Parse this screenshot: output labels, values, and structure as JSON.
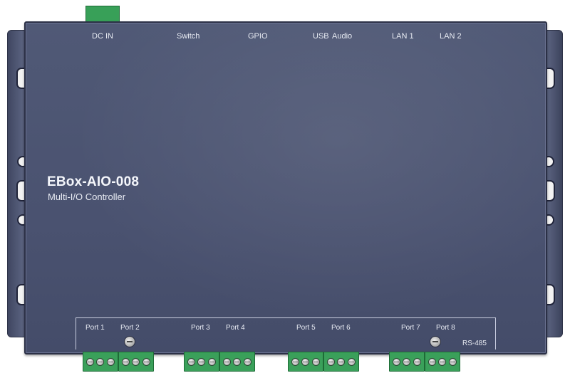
{
  "device": {
    "model": "EBox-AIO-008",
    "description": "Multi-I/O Controller"
  },
  "top_ports": {
    "dc_in": "DC IN",
    "switch": "Switch",
    "gpio": "GPIO",
    "usb": "USB",
    "audio": "Audio",
    "lan1": "LAN 1",
    "lan2": "LAN 2"
  },
  "bottom_ports": {
    "port1": "Port 1",
    "port2": "Port 2",
    "port3": "Port 3",
    "port4": "Port 4",
    "port5": "Port 5",
    "port6": "Port 6",
    "port7": "Port 7",
    "port8": "Port 8",
    "bus": "RS-485"
  },
  "colors": {
    "enclosure": "#4a5270",
    "terminal_block": "#3aa05a",
    "label_text": "#e8ebf3"
  }
}
